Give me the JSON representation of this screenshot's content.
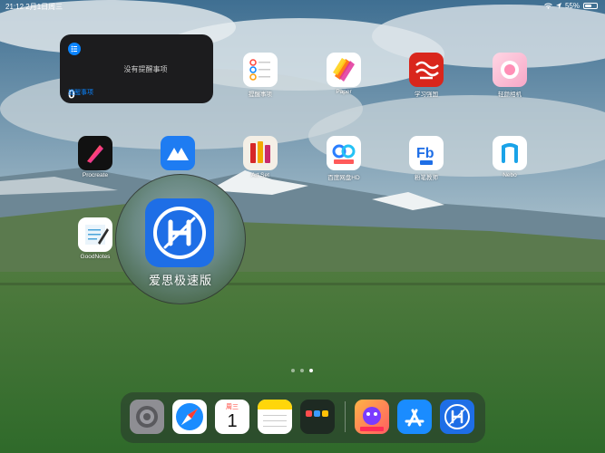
{
  "status_bar": {
    "time_date": "21:12  2月1日周三",
    "battery_percent": "55%",
    "battery_level": 0.55
  },
  "widget": {
    "empty_text": "没有提醒事项",
    "count": "0",
    "name": "提醒事项"
  },
  "apps": [
    {
      "label": "提醒事项",
      "icon": "reminders-icon"
    },
    {
      "label": "Paper",
      "icon": "paper-icon"
    },
    {
      "label": "学习强国",
      "icon": "xuexi-icon"
    },
    {
      "label": "轻颜相机",
      "icon": "light-camera-icon"
    },
    {
      "label": "Procreate",
      "icon": "procreate-icon"
    },
    {
      "label": "",
      "icon": "mindmap-app-icon"
    },
    {
      "label": "Art Set",
      "icon": "art-set-icon"
    },
    {
      "label": "百度网盘HD",
      "icon": "baidu-netdisk-icon"
    },
    {
      "label": "粉笔教师",
      "icon": "fenbi-icon"
    },
    {
      "label": "Nebo",
      "icon": "nebo-icon"
    },
    {
      "label": "GoodNotes",
      "icon": "goodnotes-icon"
    }
  ],
  "magnifier": {
    "label": "爱思极速版",
    "icon": "aisi-icon"
  },
  "page_indicator": {
    "pages": 3,
    "current": 3
  },
  "dock": {
    "calendar_weekday": "周三",
    "calendar_day": "1",
    "items": [
      {
        "icon": "settings-icon"
      },
      {
        "icon": "safari-icon"
      },
      {
        "icon": "calendar-icon"
      },
      {
        "icon": "notes-icon"
      },
      {
        "icon": "app-folder-icon"
      },
      {
        "icon": "game-app-icon"
      },
      {
        "icon": "app-store-icon"
      },
      {
        "icon": "aisi-icon"
      }
    ]
  }
}
